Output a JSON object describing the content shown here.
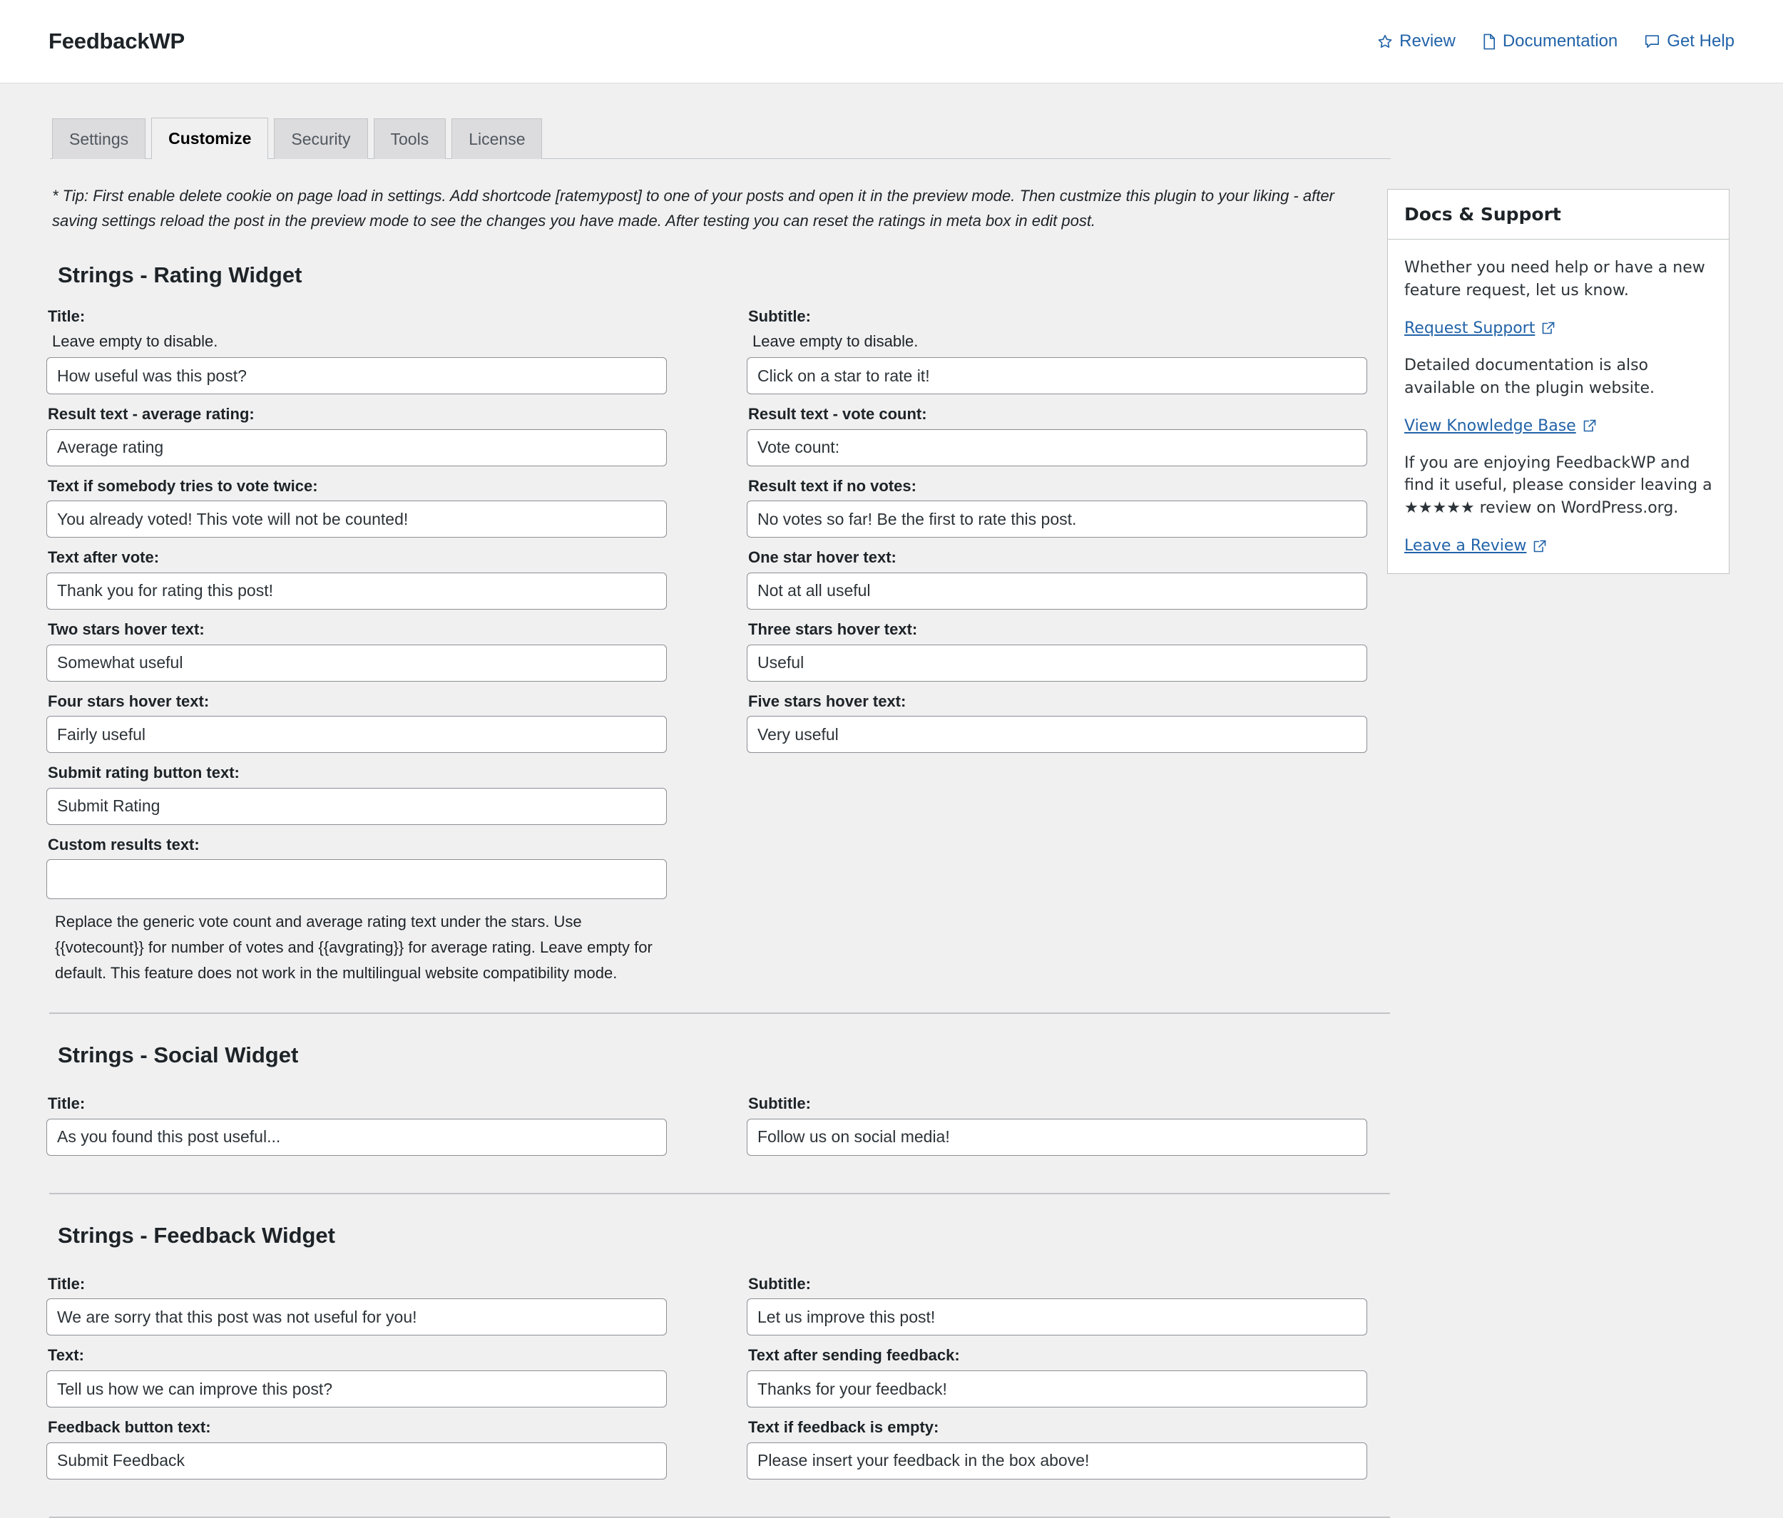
{
  "header": {
    "brand": "FeedbackWP",
    "links": [
      {
        "label": "Review",
        "icon": "star-outline-icon"
      },
      {
        "label": "Documentation",
        "icon": "document-icon"
      },
      {
        "label": "Get Help",
        "icon": "chat-bubble-icon"
      }
    ]
  },
  "tabs": [
    {
      "label": "Settings",
      "active": false
    },
    {
      "label": "Customize",
      "active": true
    },
    {
      "label": "Security",
      "active": false
    },
    {
      "label": "Tools",
      "active": false
    },
    {
      "label": "License",
      "active": false
    }
  ],
  "tip": "* Tip: First enable delete cookie on page load in settings. Add shortcode [ratemypost] to one of your posts and open it in the preview mode. Then custmize this plugin to your liking - after saving settings reload the post in the preview mode to see the changes you have made. After testing you can reset the ratings in meta box in edit post.",
  "rating_widget": {
    "title": "Strings - Rating Widget",
    "left": {
      "title_label": "Title:",
      "title_hint": "Leave empty to disable.",
      "title_value": "How useful was this post?",
      "avg_label": "Result text - average rating:",
      "avg_value": "Average rating",
      "twice_label": "Text if somebody tries to vote twice:",
      "twice_value": "You already voted! This vote will not be counted!",
      "after_vote_label": "Text after vote:",
      "after_vote_value": "Thank you for rating this post!",
      "two_stars_label": "Two stars hover text:",
      "two_stars_value": "Somewhat useful",
      "four_stars_label": "Four stars hover text:",
      "four_stars_value": "Fairly useful",
      "submit_label": "Submit rating button text:",
      "submit_value": "Submit Rating",
      "custom_results_label": "Custom results text:",
      "custom_results_value": "",
      "custom_results_placeholder": "",
      "custom_results_desc": "Replace the generic vote count and average rating text under the stars. Use {{votecount}} for number of votes and {{avgrating}} for average rating. Leave empty for default. This feature does not work in the multilingual website compatibility mode."
    },
    "right": {
      "subtitle_label": "Subtitle:",
      "subtitle_hint": "Leave empty to disable.",
      "subtitle_value": "Click on a star to rate it!",
      "votecount_label": "Result text - vote count:",
      "votecount_value": "Vote count:",
      "novotes_label": "Result text if no votes:",
      "novotes_value": "No votes so far! Be the first to rate this post.",
      "one_star_label": "One star hover text:",
      "one_star_value": "Not at all useful",
      "three_stars_label": "Three stars hover text:",
      "three_stars_value": "Useful",
      "five_stars_label": "Five stars hover text:",
      "five_stars_value": "Very useful"
    }
  },
  "social_widget": {
    "title": "Strings - Social Widget",
    "title_label": "Title:",
    "title_value": "As you found this post useful...",
    "subtitle_label": "Subtitle:",
    "subtitle_value": "Follow us on social media!"
  },
  "feedback_widget": {
    "title": "Strings - Feedback Widget",
    "title_label": "Title:",
    "title_value": "We are sorry that this post was not useful for you!",
    "subtitle_label": "Subtitle:",
    "subtitle_value": "Let us improve this post!",
    "text_label": "Text:",
    "text_value": "Tell us how we can improve this post?",
    "after_send_label": "Text after sending feedback:",
    "after_send_value": "Thanks for your feedback!",
    "button_label": "Feedback button text:",
    "button_value": "Submit Feedback",
    "empty_label": "Text if feedback is empty:",
    "empty_value": "Please insert your feedback in the box above!"
  },
  "docs_card": {
    "heading": "Docs & Support",
    "para1": "Whether you need help or have a new feature request, let us know.",
    "link1": "Request Support",
    "para2": "Detailed documentation is also available on the plugin website.",
    "link2": "View Knowledge Base",
    "para3_pre": "If you are enjoying FeedbackWP and find it useful, please consider leaving a ",
    "stars": "★★★★★",
    "para3_post": " review on WordPress.org.",
    "link3": "Leave a Review"
  },
  "colors": {
    "link": "#2263a8",
    "page_bg": "#f0f0f1",
    "panel_bg": "#ffffff",
    "border": "#c3c4c7",
    "input_border": "#8c8f94",
    "text": "#1d2327"
  }
}
